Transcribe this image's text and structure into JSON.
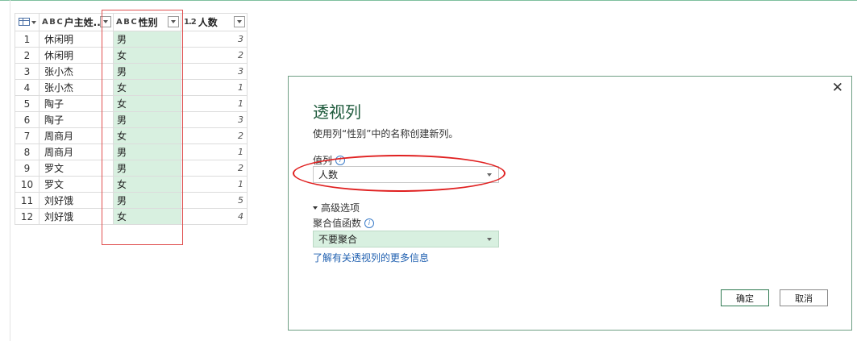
{
  "grid": {
    "columns": [
      {
        "type": "A B C",
        "label": "户主姓..."
      },
      {
        "type": "A B C",
        "label": "性别"
      },
      {
        "type": "1.2",
        "label": "人数"
      }
    ],
    "rows": [
      {
        "n": "1",
        "name": "休闲明",
        "sex": "男",
        "count": "3"
      },
      {
        "n": "2",
        "name": "休闲明",
        "sex": "女",
        "count": "2"
      },
      {
        "n": "3",
        "name": "张小杰",
        "sex": "男",
        "count": "3"
      },
      {
        "n": "4",
        "name": "张小杰",
        "sex": "女",
        "count": "1"
      },
      {
        "n": "5",
        "name": "陶子",
        "sex": "女",
        "count": "1"
      },
      {
        "n": "6",
        "name": "陶子",
        "sex": "男",
        "count": "3"
      },
      {
        "n": "7",
        "name": "周商月",
        "sex": "女",
        "count": "2"
      },
      {
        "n": "8",
        "name": "周商月",
        "sex": "男",
        "count": "1"
      },
      {
        "n": "9",
        "name": "罗文",
        "sex": "男",
        "count": "2"
      },
      {
        "n": "10",
        "name": "罗文",
        "sex": "女",
        "count": "1"
      },
      {
        "n": "11",
        "name": "刘好饿",
        "sex": "男",
        "count": "5"
      },
      {
        "n": "12",
        "name": "刘好饿",
        "sex": "女",
        "count": "4"
      }
    ]
  },
  "dialog": {
    "close": "✕",
    "title": "透视列",
    "description": "使用列“性别”中的名称创建新列。",
    "values_label": "值列",
    "values_selected": "人数",
    "advanced_label": "高级选项",
    "agg_label": "聚合值函数",
    "agg_selected": "不要聚合",
    "info": "i",
    "link": "了解有关透视列的更多信息",
    "ok": "确定",
    "cancel": "取消"
  },
  "colors": {
    "accent": "#1e5a3c",
    "selected_column": "#d8f0e0",
    "annotation": "#e02020"
  }
}
